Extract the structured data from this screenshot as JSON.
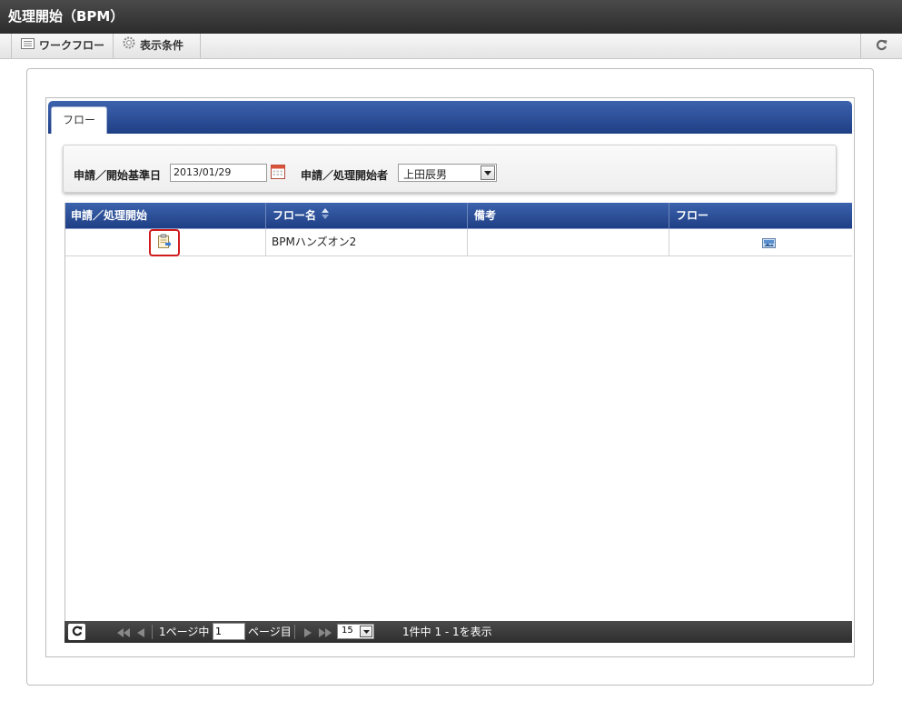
{
  "window": {
    "title": "処理開始（BPM）"
  },
  "toolbar": {
    "workflow_label": "ワークフロー",
    "display_conditions_label": "表示条件",
    "refresh_icon": "refresh-icon"
  },
  "tabs": [
    {
      "label": "フロー",
      "active": true
    }
  ],
  "search": {
    "base_date_label": "申請／開始基準日",
    "base_date_value": "2013/01/29",
    "calendar_icon": "calendar-icon",
    "starter_label": "申請／処理開始者",
    "starter_value": "上田辰男"
  },
  "grid": {
    "columns": [
      "申請／処理開始",
      "フロー名",
      "備考",
      "フロー"
    ],
    "sorted_column": "フロー名",
    "rows": [
      {
        "start_icon": "clipboard-start-icon",
        "flow_name": "BPMハンズオン2",
        "note": "",
        "flow_icon": "flow-image-icon"
      }
    ]
  },
  "pager": {
    "page_label_prefix": "1ページ中",
    "page_value": "1",
    "page_label_suffix": "ページ目",
    "per_page": "15",
    "summary": "1件中 1 - 1を表示"
  },
  "colors": {
    "header_blue": "#2b4f9a",
    "highlight_red": "#d01c1c",
    "title_dark": "#333333"
  }
}
